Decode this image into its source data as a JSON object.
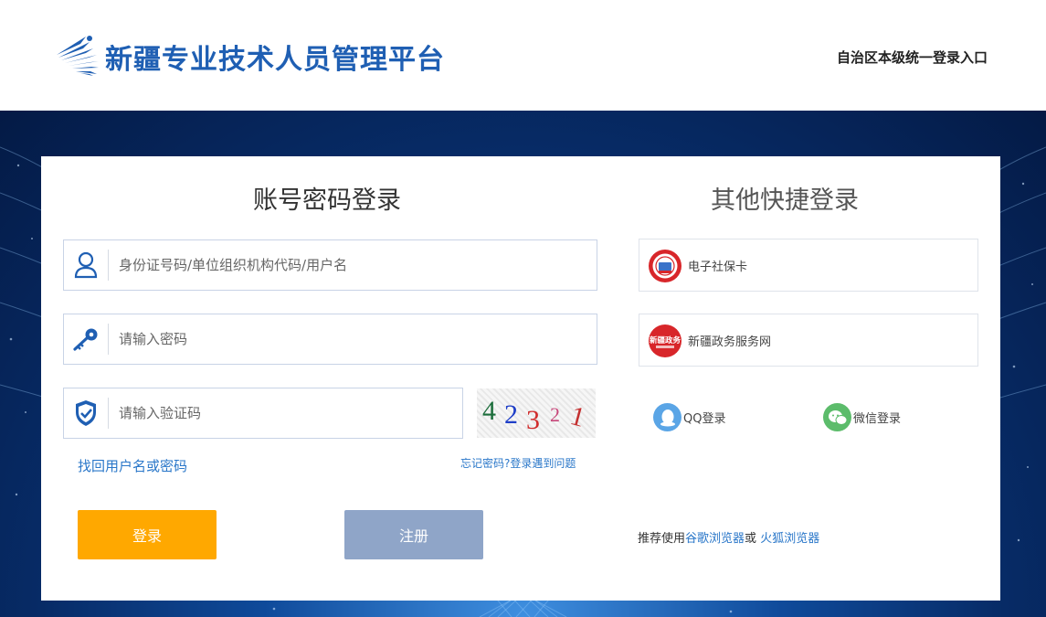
{
  "header": {
    "site_title": "新疆专业技术人员管理平台",
    "entry_text": "自治区本级统一登录入口"
  },
  "account_login": {
    "title": "账号密码登录",
    "username_placeholder": "身份证号码/单位组织机构代码/用户名",
    "password_placeholder": "请输入密码",
    "captcha_placeholder": "请输入验证码",
    "captcha_code": "42321",
    "find_account_link": "找回用户名或密码",
    "forgot_link": "忘记密码?登录遇到问题",
    "login_button": "登录",
    "register_button": "注册"
  },
  "quick_login": {
    "title": "其他快捷登录",
    "social_security": {
      "label": "电子社保卡",
      "icon": "social-security-card-icon"
    },
    "gov_service": {
      "label": "新疆政务服务网",
      "icon_text": "新疆政务",
      "icon": "xinjiang-gov-service-icon"
    },
    "qq": {
      "label": "QQ登录",
      "icon": "qq-icon"
    },
    "wechat": {
      "label": "微信登录",
      "icon": "wechat-icon"
    }
  },
  "recommend": {
    "prefix": "推荐使用",
    "chrome": "谷歌浏览器",
    "or": "或",
    "firefox": "火狐浏览器"
  },
  "colors": {
    "brand_blue": "#1f5fb3",
    "login_orange": "#ffa800",
    "register_grey_blue": "#8fa5c8",
    "link_blue": "#2a77c9",
    "qq_blue": "#5aa5e6",
    "wechat_green": "#5cbc6b",
    "gov_red": "#d8262a"
  }
}
